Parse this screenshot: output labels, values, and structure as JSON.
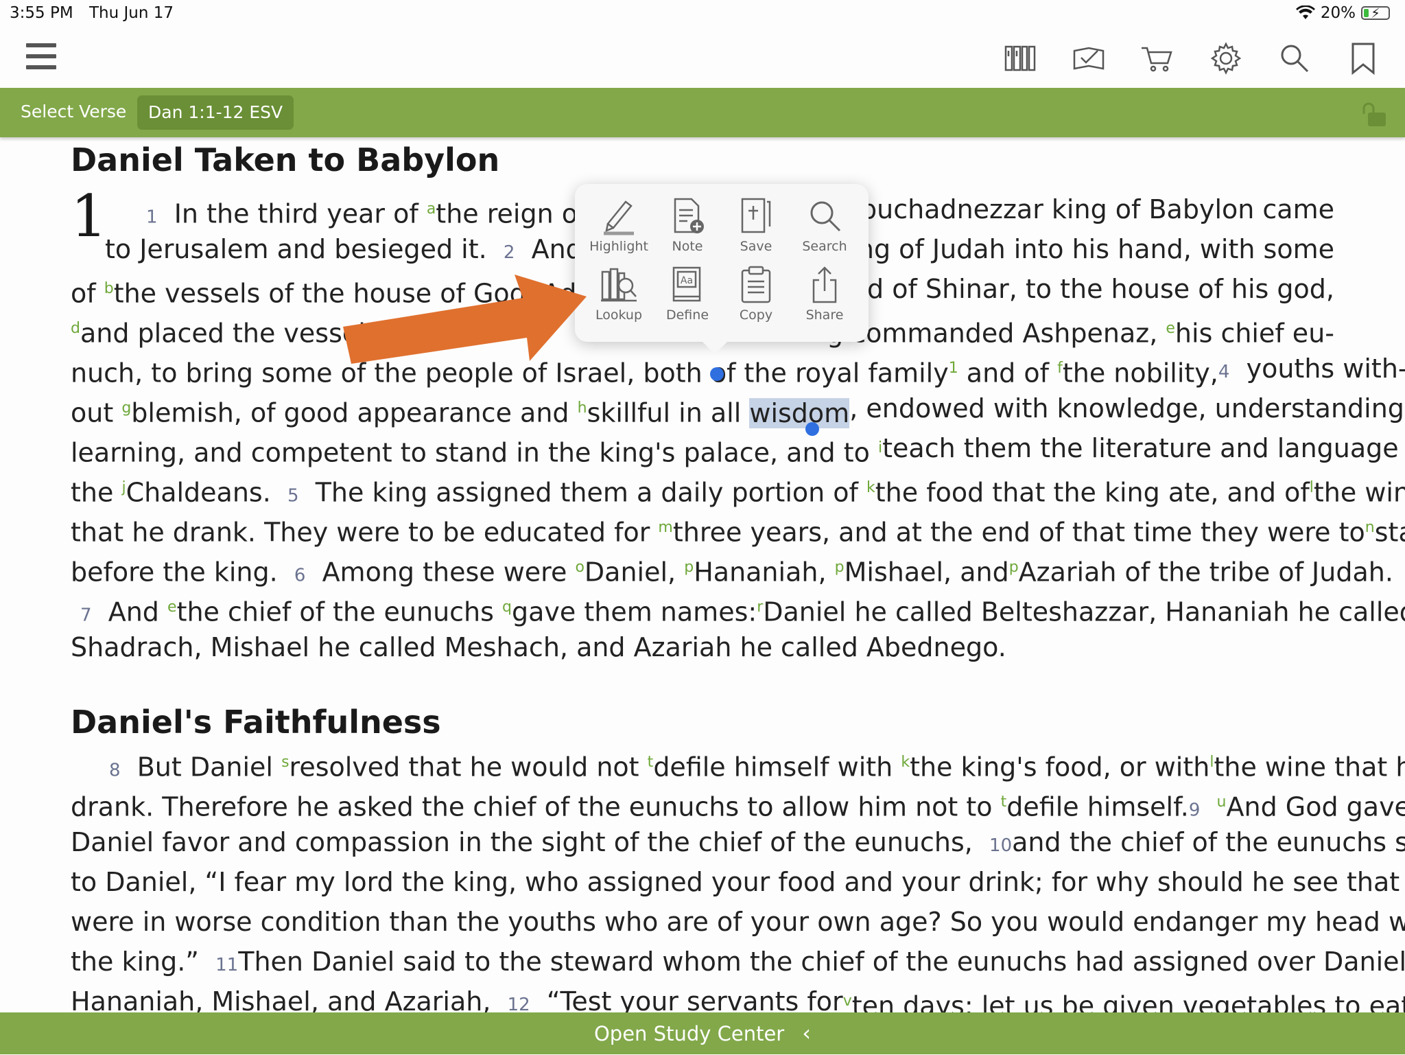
{
  "status": {
    "time": "3:55 PM",
    "date": "Thu Jun 17",
    "battery": "20%",
    "battery_level": 0.2
  },
  "toolbar": {
    "icons": [
      "library-icon",
      "reading-plan-icon",
      "cart-icon",
      "settings-icon",
      "search-icon",
      "bookmark-icon"
    ]
  },
  "nav": {
    "select_verse": "Select Verse",
    "reference": "Dan 1:1-12 ESV"
  },
  "passage": {
    "heading1": "Daniel Taken to Babylon",
    "chapter": "1",
    "heading2": "Daniel's Faithfulness",
    "selected_word": "wisdom"
  },
  "popup": {
    "actions": [
      {
        "label": "Highlight",
        "icon": "highlight-pen-icon"
      },
      {
        "label": "Note",
        "icon": "note-add-icon"
      },
      {
        "label": "Save",
        "icon": "save-book-icon"
      },
      {
        "label": "Search",
        "icon": "search-icon"
      },
      {
        "label": "Lookup",
        "icon": "lookup-icon"
      },
      {
        "label": "Define",
        "icon": "define-dictionary-icon"
      },
      {
        "label": "Copy",
        "icon": "copy-clipboard-icon"
      },
      {
        "label": "Share",
        "icon": "share-icon"
      }
    ]
  },
  "annotation": {
    "arrow_color": "#e0702e",
    "points_to": "Lookup"
  },
  "colors": {
    "accent_green": "#82a84a",
    "pill_green": "#6a8f36",
    "footnote_green": "#6fa83a",
    "selection": "#c6d3e6",
    "handle_blue": "#2f6fe0"
  },
  "footer": {
    "label": "Open Study Center"
  },
  "lines": {
    "l1a": "1",
    "l1b": "In the third year of",
    "l1c": "a",
    "l1d": "the reign of Je",
    "l1e": "Nebuchadnezzar king of Babylon came",
    "l2a": "to Jerusalem and besieged it.",
    "l2b": "2",
    "l2c": "And th",
    "l2d": "king of Judah into his hand, with some",
    "l3a": "of",
    "l3b": "b",
    "l3c": "the vessels of the house of God. A",
    "l3d": "d h",
    "l3e": "land of Shinar, to the house of his god,",
    "l4a": "d",
    "l4b": "and placed the vessels i",
    "l4c": "g commanded Ashpenaz,",
    "l4d": "e",
    "l4e": "his chief eu-",
    "l5a": "nuch, to bring some of the people of Israel, both of the royal family",
    "l5b": "1",
    "l5c": "and of",
    "l5d": "f",
    "l5e": "the nobility,",
    "l5f": "4",
    "l5g": "youths with-",
    "l6a": "out",
    "l6b": "g",
    "l6c": "blemish, of good appearance and",
    "l6d": "h",
    "l6e": "skillful in all",
    "l6f": ", endowed with knowledge, understanding",
    "l7a": "learning, and competent to stand in the king's palace, and to",
    "l7b": "i",
    "l7c": "teach them the literature and language of",
    "l8a": "the",
    "l8b": "j",
    "l8c": "Chaldeans.",
    "l8d": "5",
    "l8e": "The king assigned them a daily portion of",
    "l8f": "k",
    "l8g": "the food that the king ate, and of",
    "l8h": "l",
    "l8i": "the wine",
    "l9a": "that he drank. They were to be educated for",
    "l9b": "m",
    "l9c": "three years, and at the end of that time they were to",
    "l9d": "n",
    "l9e": "stand",
    "l10a": "before the king.",
    "l10b": "6",
    "l10c": "Among these were",
    "l10d": "o",
    "l10e": "Daniel,",
    "l10f": "p",
    "l10g": "Hananiah,",
    "l10h": "p",
    "l10i": "Mishael, and",
    "l10j": "p",
    "l10k": "Azariah of the tribe of Judah.",
    "l11a": "7",
    "l11b": "And",
    "l11c": "e",
    "l11d": "the chief of the eunuchs",
    "l11e": "q",
    "l11f": "gave them names:",
    "l11g": "r",
    "l11h": "Daniel he called Belteshazzar, Hananiah he called",
    "l12a": "Shadrach, Mishael he called Meshach, and Azariah he called Abednego.",
    "l13a": "8",
    "l13b": "But Daniel",
    "l13c": "s",
    "l13d": "resolved that he would not",
    "l13e": "t",
    "l13f": "defile himself with",
    "l13g": "k",
    "l13h": "the king's food, or with",
    "l13i": "l",
    "l13j": "the wine that he",
    "l14a": "drank. Therefore he asked the chief of the eunuchs to allow him not to",
    "l14b": "t",
    "l14c": "defile himself.",
    "l14d": "9",
    "l14e": "u",
    "l14f": "And God gave",
    "l15a": "Daniel favor and compassion in the sight of the chief of the eunuchs,",
    "l15b": "10",
    "l15c": "and the chief of the eunuchs said",
    "l16a": "to Daniel, “I fear my lord the king, who assigned your food and your drink; for why should he see that you",
    "l17a": "were in worse condition than the youths who are of your own age? So you would endanger my head with",
    "l18a": "the king.”",
    "l18b": "11",
    "l18c": "Then Daniel said to the steward whom the chief of the eunuchs had assigned over Daniel,",
    "l19a": "Hananiah, Mishael, and Azariah,",
    "l19b": "12",
    "l19c": "“Test your servants for",
    "l19d": "v",
    "l19e": "ten days; let us be given vegetables to eat"
  }
}
